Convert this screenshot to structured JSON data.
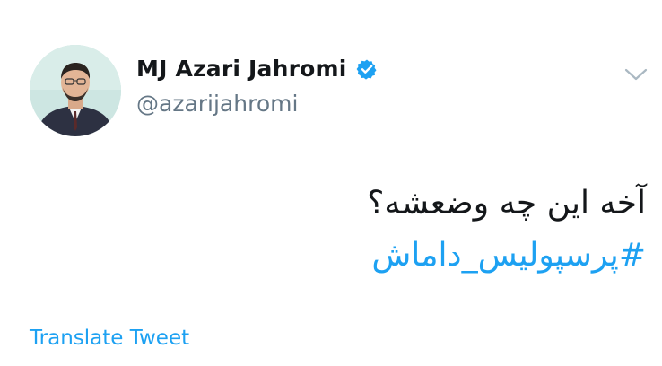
{
  "author": {
    "display_name": "MJ Azari Jahromi",
    "handle": "@azarijahromi",
    "verified": true
  },
  "tweet": {
    "text": "آخه این چه وضعشه؟",
    "hashtag": "#پرسپولیس_داماش"
  },
  "actions": {
    "translate_label": "Translate Tweet"
  },
  "icons": {
    "verified": "verified-badge-icon",
    "menu": "chevron-down-icon"
  },
  "colors": {
    "accent": "#1da1f2",
    "text": "#14171a",
    "secondary_text": "#657786"
  }
}
